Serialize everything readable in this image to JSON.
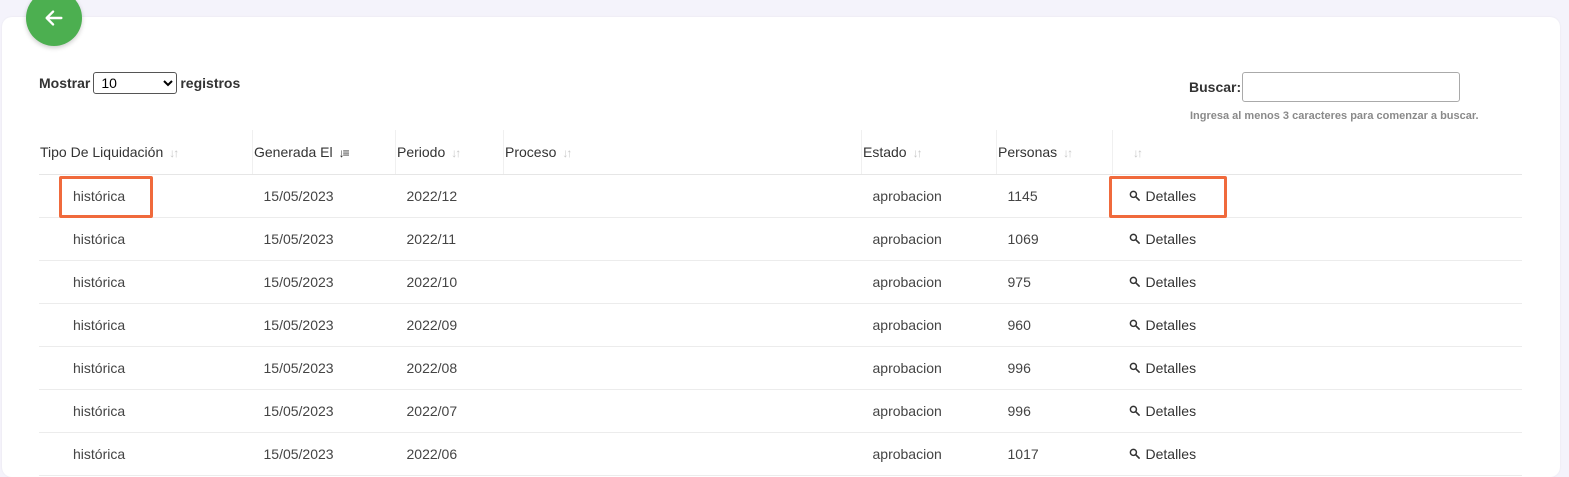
{
  "colors": {
    "back_button": "#4caf50",
    "highlight": "#f06a3c",
    "background": "#f4f3fb"
  },
  "back_button": {
    "icon": "arrow-left-icon"
  },
  "length_menu": {
    "prefix": "Mostrar",
    "selected": "10",
    "suffix": "registros"
  },
  "search": {
    "label": "Buscar:",
    "value": "",
    "hint": "Ingresa al menos 3 caracteres para comenzar a buscar."
  },
  "table": {
    "columns": [
      {
        "label": "Tipo De Liquidación",
        "sort": "unsorted"
      },
      {
        "label": "Generada El",
        "sort": "descending"
      },
      {
        "label": "Periodo",
        "sort": "unsorted"
      },
      {
        "label": "Proceso",
        "sort": "unsorted"
      },
      {
        "label": "Estado",
        "sort": "unsorted"
      },
      {
        "label": "Personas",
        "sort": "unsorted"
      },
      {
        "label": "",
        "sort": "unsorted"
      }
    ],
    "action_label": "Detalles",
    "rows": [
      {
        "tipo": "histórica",
        "generada": "15/05/2023",
        "periodo": "2022/12",
        "proceso": "",
        "estado": "aprobacion",
        "personas": "1145"
      },
      {
        "tipo": "histórica",
        "generada": "15/05/2023",
        "periodo": "2022/11",
        "proceso": "",
        "estado": "aprobacion",
        "personas": "1069"
      },
      {
        "tipo": "histórica",
        "generada": "15/05/2023",
        "periodo": "2022/10",
        "proceso": "",
        "estado": "aprobacion",
        "personas": "975"
      },
      {
        "tipo": "histórica",
        "generada": "15/05/2023",
        "periodo": "2022/09",
        "proceso": "",
        "estado": "aprobacion",
        "personas": "960"
      },
      {
        "tipo": "histórica",
        "generada": "15/05/2023",
        "periodo": "2022/08",
        "proceso": "",
        "estado": "aprobacion",
        "personas": "996"
      },
      {
        "tipo": "histórica",
        "generada": "15/05/2023",
        "periodo": "2022/07",
        "proceso": "",
        "estado": "aprobacion",
        "personas": "996"
      },
      {
        "tipo": "histórica",
        "generada": "15/05/2023",
        "periodo": "2022/06",
        "proceso": "",
        "estado": "aprobacion",
        "personas": "1017"
      }
    ]
  }
}
